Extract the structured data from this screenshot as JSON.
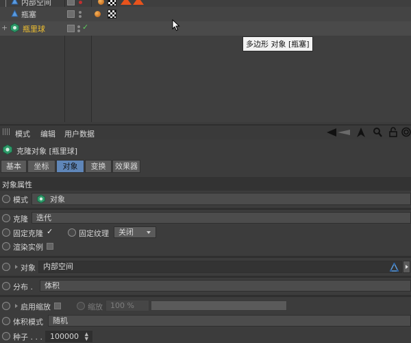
{
  "object_manager": {
    "objects": [
      {
        "name": "内部空间",
        "name_color": "#cfcfcf",
        "has_check": false
      },
      {
        "name": "瓶塞",
        "name_color": "#cfcfcf",
        "has_check": false
      },
      {
        "name": "瓶里球",
        "name_color": "#f0c030",
        "has_check": true
      }
    ],
    "check_glyph": "✓",
    "expand_glyph": "+",
    "tooltip": "多边形 对象 [瓶塞]"
  },
  "attribute_manager": {
    "menu": {
      "mode": "模式",
      "edit": "编辑",
      "user_data": "用户数据"
    },
    "toolbar_icons": [
      "back-arrow-icon",
      "up-arrow-icon",
      "search-icon",
      "lock-icon",
      "target-icon"
    ],
    "title": "克隆对象 [瓶里球]",
    "tabs": [
      {
        "label": "基本",
        "active": false
      },
      {
        "label": "坐标",
        "active": false
      },
      {
        "label": "对象",
        "active": true
      },
      {
        "label": "变换",
        "active": false
      },
      {
        "label": "效果器",
        "active": false
      }
    ],
    "section_title": "对象属性",
    "mode": {
      "label": "模式",
      "value": "对象"
    },
    "clone": {
      "label": "克隆",
      "value": "迭代"
    },
    "fixed_clone": {
      "label": "固定克隆",
      "checked": true,
      "check_glyph": "✓"
    },
    "fixed_texture": {
      "label": "固定纹理",
      "value": "关闭"
    },
    "render_instances": {
      "label": "渲染实例",
      "checked": false
    },
    "object_link": {
      "label": "对象",
      "value": "内部空间"
    },
    "distribution": {
      "label": "分布 .",
      "value": "体积"
    },
    "enable_scale": {
      "label": "启用缩放",
      "checked": false
    },
    "scale": {
      "label": "缩放",
      "value": "100 %",
      "progress": 1.0
    },
    "volume_mode": {
      "label": "体积模式",
      "value": "随机"
    },
    "seed": {
      "label": "种子 . . .",
      "value": "100000"
    }
  },
  "colors": {
    "accent_tab": "#5f86b8",
    "selected_object": "#f0c030",
    "tag_red": "#e8531c"
  }
}
